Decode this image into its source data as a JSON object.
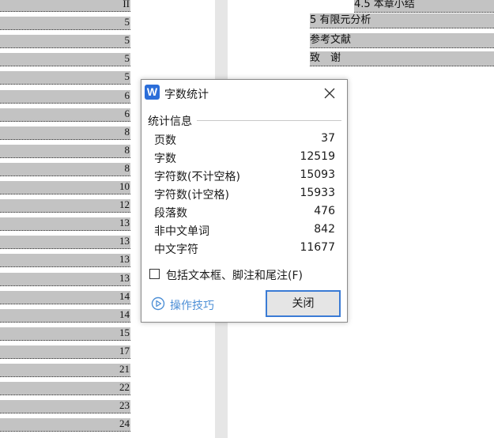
{
  "document": {
    "left_toc_numbers": [
      "II",
      "5",
      "5",
      "5",
      "5",
      "6",
      "6",
      "8",
      "8",
      "8",
      "10",
      "12",
      "13",
      "13",
      "13",
      "13",
      "14",
      "14",
      "15",
      "17",
      "21",
      "22",
      "23",
      "24"
    ],
    "right_toc_entries": [
      {
        "text": "4.5 本章小结"
      },
      {
        "text": "5 有限元分析"
      },
      {
        "text": "参考文献"
      },
      {
        "text": "致　谢"
      }
    ]
  },
  "dialog": {
    "app_icon_letter": "W",
    "title": "字数统计",
    "section_title": "统计信息",
    "stats": [
      {
        "label": "页数",
        "value": "37"
      },
      {
        "label": "字数",
        "value": "12519"
      },
      {
        "label": "字符数(不计空格)",
        "value": "15093"
      },
      {
        "label": "字符数(计空格)",
        "value": "15933"
      },
      {
        "label": "段落数",
        "value": "476"
      },
      {
        "label": "非中文单词",
        "value": "842"
      },
      {
        "label": "中文字符",
        "value": "11677"
      }
    ],
    "checkbox_label": "包括文本框、脚注和尾注(F)",
    "checkbox_checked": false,
    "tips_label": "操作技巧",
    "close_button_label": "关闭",
    "accent_color": "#3a7bd5",
    "link_color": "#4d8fd6"
  }
}
